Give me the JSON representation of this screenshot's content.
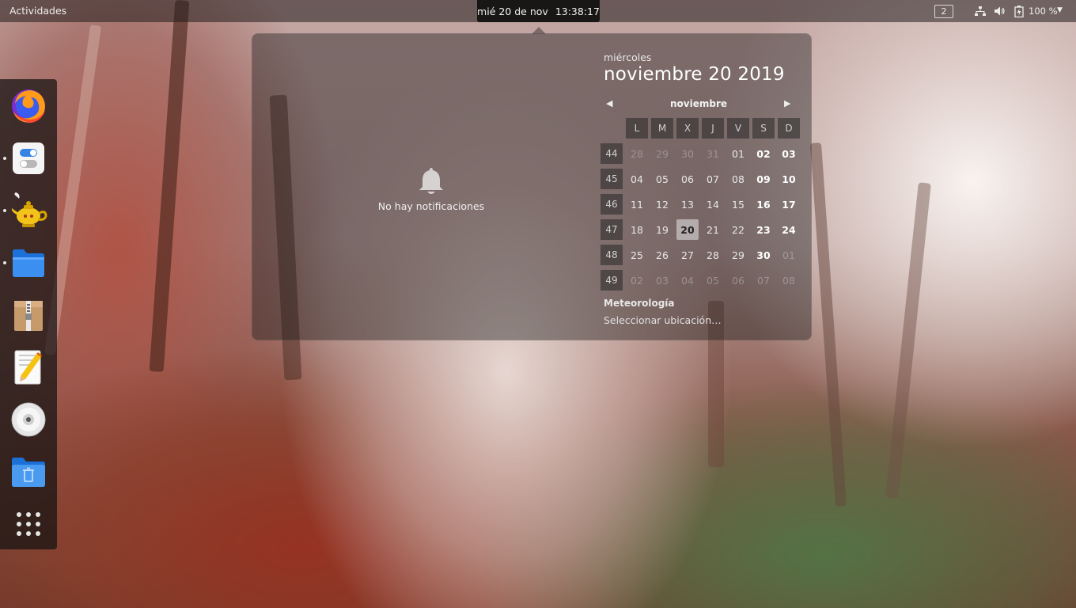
{
  "topbar": {
    "activities_label": "Actividades",
    "clock_date": "mié 20 de nov",
    "clock_time": "13:38:17",
    "workspace_number": "2",
    "battery_percent": "100 %"
  },
  "dock": {
    "apps": [
      {
        "name": "firefox-icon",
        "running": false
      },
      {
        "name": "settings-toggle-icon",
        "running": true
      },
      {
        "name": "genie-lamp-icon",
        "running": true
      },
      {
        "name": "files-folder-icon",
        "running": true
      },
      {
        "name": "archive-manager-icon",
        "running": false
      },
      {
        "name": "text-editor-icon",
        "running": false
      },
      {
        "name": "disc-icon",
        "running": false
      },
      {
        "name": "trash-folder-icon",
        "running": false
      },
      {
        "name": "show-apps-grid-icon",
        "running": false
      }
    ]
  },
  "notifications": {
    "empty_label": "No hay notificaciones"
  },
  "calendar": {
    "weekday": "miércoles",
    "full_date": "noviembre 20 2019",
    "month_label": "noviembre",
    "day_headers": [
      "L",
      "M",
      "X",
      "J",
      "V",
      "S",
      "D"
    ],
    "weeks": [
      {
        "num": "44",
        "days": [
          "28",
          "29",
          "30",
          "31",
          "01",
          "02",
          "03"
        ]
      },
      {
        "num": "45",
        "days": [
          "04",
          "05",
          "06",
          "07",
          "08",
          "09",
          "10"
        ]
      },
      {
        "num": "46",
        "days": [
          "11",
          "12",
          "13",
          "14",
          "15",
          "16",
          "17"
        ]
      },
      {
        "num": "47",
        "days": [
          "18",
          "19",
          "20",
          "21",
          "22",
          "23",
          "24"
        ]
      },
      {
        "num": "48",
        "days": [
          "25",
          "26",
          "27",
          "28",
          "29",
          "30",
          "01"
        ]
      },
      {
        "num": "49",
        "days": [
          "02",
          "03",
          "04",
          "05",
          "06",
          "07",
          "08"
        ]
      }
    ],
    "today": "20"
  },
  "weather": {
    "title": "Meteorología",
    "location_prompt": "Seleccionar ubicación…"
  },
  "colors": {
    "panel_bg": "#1c1c1c",
    "text": "#eeeeec",
    "today_highlight": "#e6e6e6"
  }
}
